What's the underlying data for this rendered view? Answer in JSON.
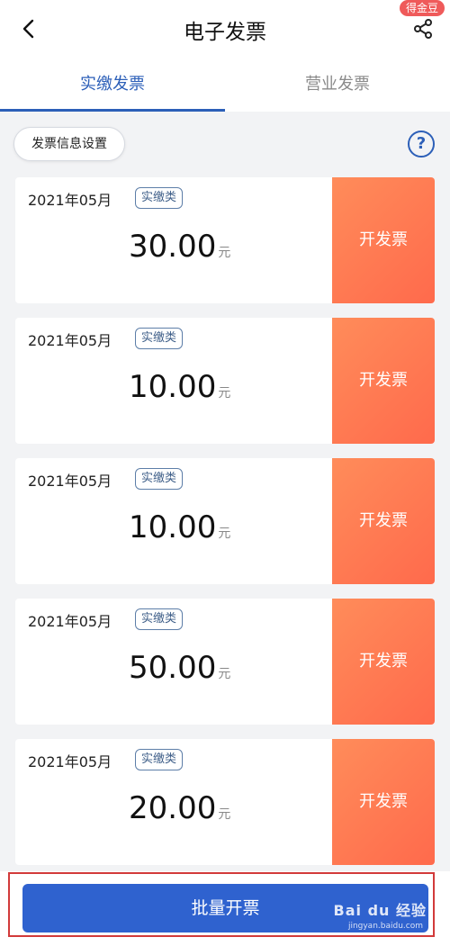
{
  "header": {
    "title": "电子发票",
    "badge": "得金豆"
  },
  "tabs": [
    {
      "label": "实缴发票",
      "active": true
    },
    {
      "label": "营业发票",
      "active": false
    }
  ],
  "toolbar": {
    "settings_label": "发票信息设置",
    "help_label": "?"
  },
  "invoices": [
    {
      "date": "2021年05月",
      "tag": "实缴类",
      "amount": "30.00",
      "unit": "元",
      "action": "开发票"
    },
    {
      "date": "2021年05月",
      "tag": "实缴类",
      "amount": "10.00",
      "unit": "元",
      "action": "开发票"
    },
    {
      "date": "2021年05月",
      "tag": "实缴类",
      "amount": "10.00",
      "unit": "元",
      "action": "开发票"
    },
    {
      "date": "2021年05月",
      "tag": "实缴类",
      "amount": "50.00",
      "unit": "元",
      "action": "开发票"
    },
    {
      "date": "2021年05月",
      "tag": "实缴类",
      "amount": "20.00",
      "unit": "元",
      "action": "开发票"
    }
  ],
  "footer": {
    "batch_label": "批量开票",
    "watermark": "Bai du 经验",
    "watermark_sub": "jingyan.baidu.com"
  },
  "colors": {
    "accent": "#2c5fb8",
    "issue_button": "#ff7a52",
    "batch_button": "#2f62cf",
    "highlight": "#d23a3a"
  }
}
